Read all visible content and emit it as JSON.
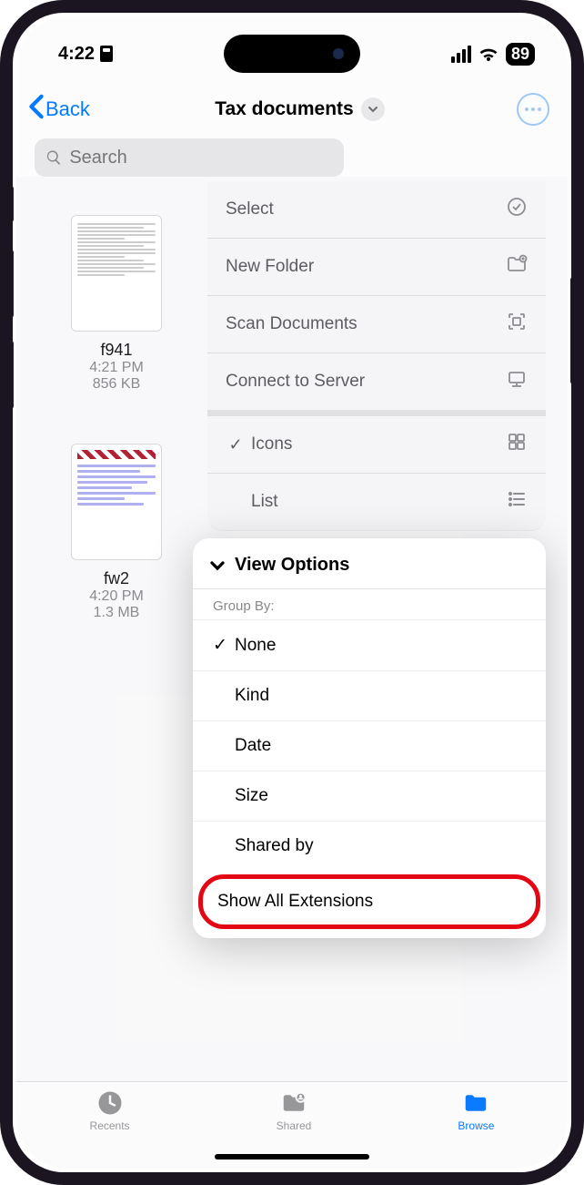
{
  "status": {
    "time": "4:22",
    "battery": "89"
  },
  "nav": {
    "back": "Back",
    "title": "Tax documents"
  },
  "search": {
    "placeholder": "Search"
  },
  "files": [
    {
      "name": "f941",
      "time": "4:21 PM",
      "size": "856 KB"
    },
    {
      "name": "fw2",
      "time": "4:20 PM",
      "size": "1.3 MB"
    }
  ],
  "menu_top": {
    "select": "Select",
    "new_folder": "New Folder",
    "scan_documents": "Scan Documents",
    "connect_to_server": "Connect to Server",
    "icons": "Icons",
    "list": "List"
  },
  "menu_bottom": {
    "header": "View Options",
    "group_by": "Group By:",
    "options": {
      "none": "None",
      "kind": "Kind",
      "date": "Date",
      "size": "Size",
      "shared_by": "Shared by"
    },
    "show_all_extensions": "Show All Extensions"
  },
  "tabs": {
    "recents": "Recents",
    "shared": "Shared",
    "browse": "Browse"
  }
}
